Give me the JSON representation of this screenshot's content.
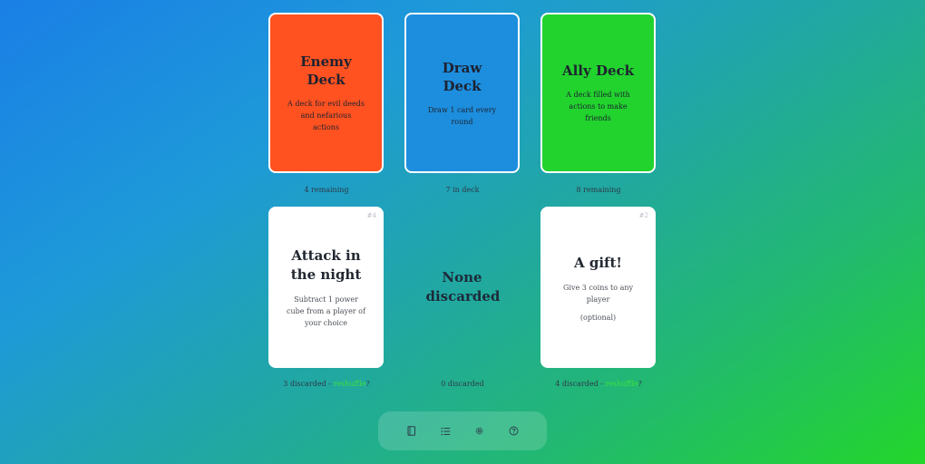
{
  "decks": [
    {
      "title": "Enemy Deck",
      "desc": "A deck for evil deeds and nefarious actions",
      "count": "4 remaining",
      "color": "#ff5220"
    },
    {
      "title": "Draw Deck",
      "desc": "Draw 1 card every round",
      "count": "7 in deck",
      "color": "#1d8ede"
    },
    {
      "title": "Ally Deck",
      "desc": "A deck filled with actions to make friends",
      "count": "8 remaining",
      "color": "#22d32e"
    }
  ],
  "discards": [
    {
      "number": "#4",
      "title": "Attack in the night",
      "desc": "Subtract 1 power cube from a player of your choice",
      "extra": "",
      "count_prefix": "3 discarded - ",
      "undo": "reshuffle",
      "suffix": "?"
    },
    {
      "title": "None discarded",
      "count_prefix": "0 discarded"
    },
    {
      "number": "#2",
      "title": "A gift!",
      "desc": "Give 3 coins to any player",
      "extra": "(optional)",
      "count_prefix": "4 discarded - ",
      "undo": "reshuffle",
      "suffix": "?"
    }
  ],
  "toolbar": {
    "items": [
      "book-icon",
      "list-icon",
      "gear-icon",
      "help-icon"
    ]
  }
}
